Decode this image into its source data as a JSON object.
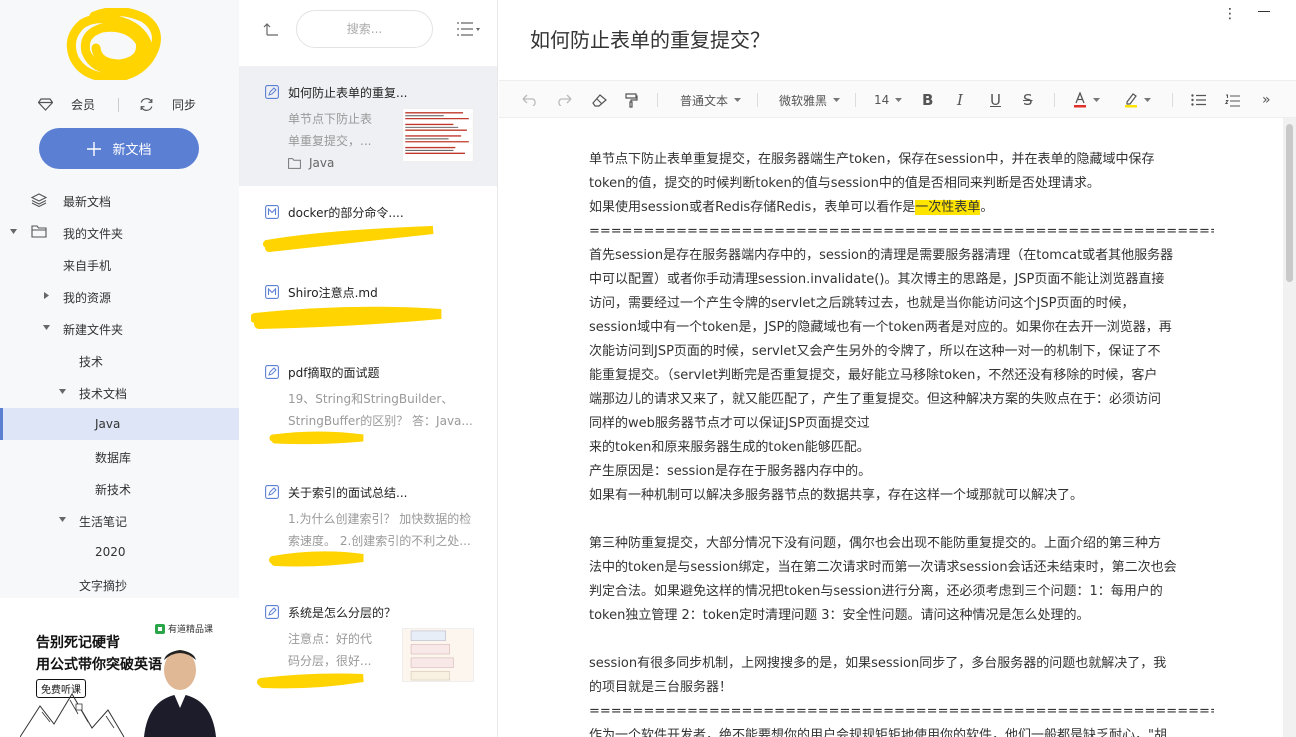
{
  "sidebar": {
    "vip_label": "会员",
    "sync_label": "同步",
    "new_doc_label": "新文档",
    "tree": [
      {
        "label": "最新文档",
        "icon": "layers-icon"
      },
      {
        "label": "我的文件夹",
        "icon": "folder-icon",
        "expanded": true
      },
      {
        "label": "来自手机"
      },
      {
        "label": "我的资源",
        "collapsed": true
      },
      {
        "label": "新建文件夹",
        "expanded": true
      },
      {
        "label": "技术"
      },
      {
        "label": "技术文档",
        "expanded": true
      },
      {
        "label": "Java",
        "active": true
      },
      {
        "label": "数据库"
      },
      {
        "label": "新技术"
      },
      {
        "label": "生活笔记",
        "expanded": true
      },
      {
        "label": "2020"
      },
      {
        "label": "文字摘抄"
      }
    ],
    "ad": {
      "brand": "有道精品课",
      "line1": "告别死记硬背",
      "line2": "用公式带你突破英语",
      "button": "免费听课"
    }
  },
  "list": {
    "search_placeholder": "搜索...",
    "notes": [
      {
        "title": "如何防止表单的重复...",
        "snippet1": "单节点下防止表",
        "snippet2": "单重复提交，...",
        "folder": "Java",
        "icon": "note-icon",
        "selected": true
      },
      {
        "title": "docker的部分命令....",
        "icon": "markdown-icon"
      },
      {
        "title": "Shiro注意点.md",
        "icon": "markdown-icon"
      },
      {
        "title": "pdf摘取的面试题",
        "snippet1": "19、String和StringBuilder、",
        "snippet2": "StringBuffer的区别？ 答：Java...",
        "icon": "note-icon"
      },
      {
        "title": "关于索引的面试总结...",
        "snippet1": "1.为什么创建索引？ 加快数据的检",
        "snippet2": "索速度。 2.创建索引的不利之处...",
        "icon": "note-icon"
      },
      {
        "title": "系统是怎么分层的？",
        "snippet1": "注意点：好的代",
        "snippet2": "码分层，很好...",
        "icon": "note-icon"
      }
    ]
  },
  "editor": {
    "title": "如何防止表单的重复提交？",
    "toolbar": {
      "paragraph": "普通文本",
      "font": "微软雅黑",
      "size": "14"
    },
    "content": [
      "单节点下防止表单重复提交，在服务器端生产token，保存在session中，并在表单的隐藏域中保存",
      "token的值，提交的时候判断token的值与session中的值是否相同来判断是否处理请求。",
      "如果使用session或者Redis存储Redis，表单可以看作是",
      "==========================================================================================",
      "首先session是存在服务器端内存中的，session的清理是需要服务器清理（在tomcat或者其他服务器",
      "中可以配置）或者你手动清理session.invalidate()。其次博主的思路是，JSP页面不能让浏览器直接",
      "访问，需要经过一个产生令牌的servlet之后跳转过去，也就是当你能访问这个JSP页面的时候，",
      "session域中有一个token是，JSP的隐藏域也有一个token两者是对应的。如果你在去开一浏览器，再",
      "次能访问到JSP页面的时候，servlet又会产生另外的令牌了，所以在这种一对一的机制下，保证了不",
      "能重复提交。（servlet判断完是否重复提交，最好能立马移除token，不然还没有移除的时候，客户",
      "端那边儿的请求又来了，就又能匹配了，产生了重复提交。但这种解决方案的失败点在于：必须访问",
      "同样的web服务器节点才可以保证JSP页面提交过",
      "来的token和原来服务器生成的token能够匹配。",
      "产生原因是：session是存在于服务器内存中的。",
      "如果有一种机制可以解决多服务器节点的数据共享，存在这样一个域那就可以解决了。",
      "",
      "第三种防重复提交，大部分情况下没有问题，偶尔也会出现不能防重复提交的。上面介绍的第三种方",
      "法中的token是与session绑定，当在第二次请求时而第一次请求session会话还未结束时，第二次也会",
      "判定合法。如果避免这样的情况把token与session进行分离，还必须考虑到三个问题：1：每用户的",
      "token独立管理 2：token定时清理问题 3：安全性问题。请问这种情况是怎么处理的。",
      "",
      "session有很多同步机制，上网搜搜多的是，如果session同步了，多台服务器的问题也就解决了，我",
      "的项目就是三台服务器！",
      "==========================================================================================",
      "作为一个软件开发者，绝不能要想你的用户会规规矩矩地使用你的软件，他们一般都是缺乏耐心，\"胡"
    ],
    "highlight": "一次性表单",
    "highlight_suffix": "。"
  },
  "colors": {
    "accent": "#5b7fd3",
    "highlight": "#ffe400",
    "sidebar_bg": "#f7f8fa"
  }
}
